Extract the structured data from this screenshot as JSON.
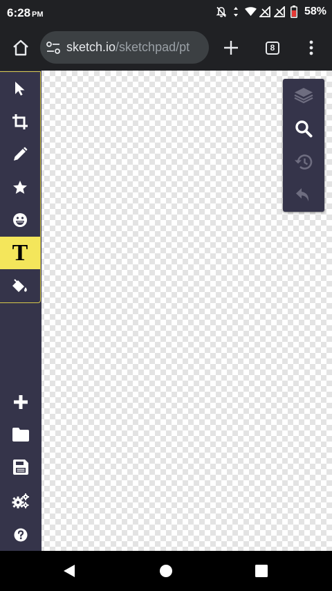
{
  "status_bar": {
    "time": "6:28",
    "ampm": "PM",
    "battery": "58%",
    "icons": [
      "notifications-off-icon",
      "data-arrows-icon",
      "wifi-icon",
      "no-signal-icon",
      "no-signal-icon",
      "battery-saver-icon"
    ]
  },
  "browser": {
    "url_host": "sketch.io",
    "url_path": "/sketchpad/pt",
    "tab_count": "8",
    "icons": [
      "home-icon",
      "site-settings-icon",
      "plus-icon",
      "tabs-icon",
      "more-vert-icon"
    ]
  },
  "left_toolbar": {
    "tools": [
      {
        "name": "select",
        "icon": "arrow-pointer-icon",
        "active": false
      },
      {
        "name": "crop",
        "icon": "crop-icon",
        "active": false
      },
      {
        "name": "pencil",
        "icon": "pencil-icon",
        "active": false
      },
      {
        "name": "stamp",
        "icon": "star-icon",
        "active": false
      },
      {
        "name": "emoji",
        "icon": "grin-emoji-icon",
        "active": false
      },
      {
        "name": "text",
        "icon": "text-T-icon",
        "active": true,
        "glyph": "T"
      },
      {
        "name": "fill",
        "icon": "paint-bucket-icon",
        "active": false
      }
    ],
    "bottom": [
      {
        "name": "new",
        "icon": "plus-icon"
      },
      {
        "name": "open",
        "icon": "folder-icon"
      },
      {
        "name": "save",
        "icon": "floppy-disk-icon"
      },
      {
        "name": "settings",
        "icon": "gears-icon"
      },
      {
        "name": "help",
        "icon": "question-circle-icon"
      }
    ],
    "active_color": "#f4e65b",
    "background": "#35344a"
  },
  "right_panel": {
    "buttons": [
      {
        "name": "layers",
        "icon": "layers-icon",
        "enabled": false
      },
      {
        "name": "zoom",
        "icon": "search-icon",
        "enabled": true
      },
      {
        "name": "history",
        "icon": "history-icon",
        "enabled": false
      },
      {
        "name": "undo",
        "icon": "undo-icon",
        "enabled": false
      }
    ]
  },
  "nav_bar": {
    "icons": [
      "back-triangle-icon",
      "home-circle-icon",
      "recents-square-icon"
    ]
  }
}
